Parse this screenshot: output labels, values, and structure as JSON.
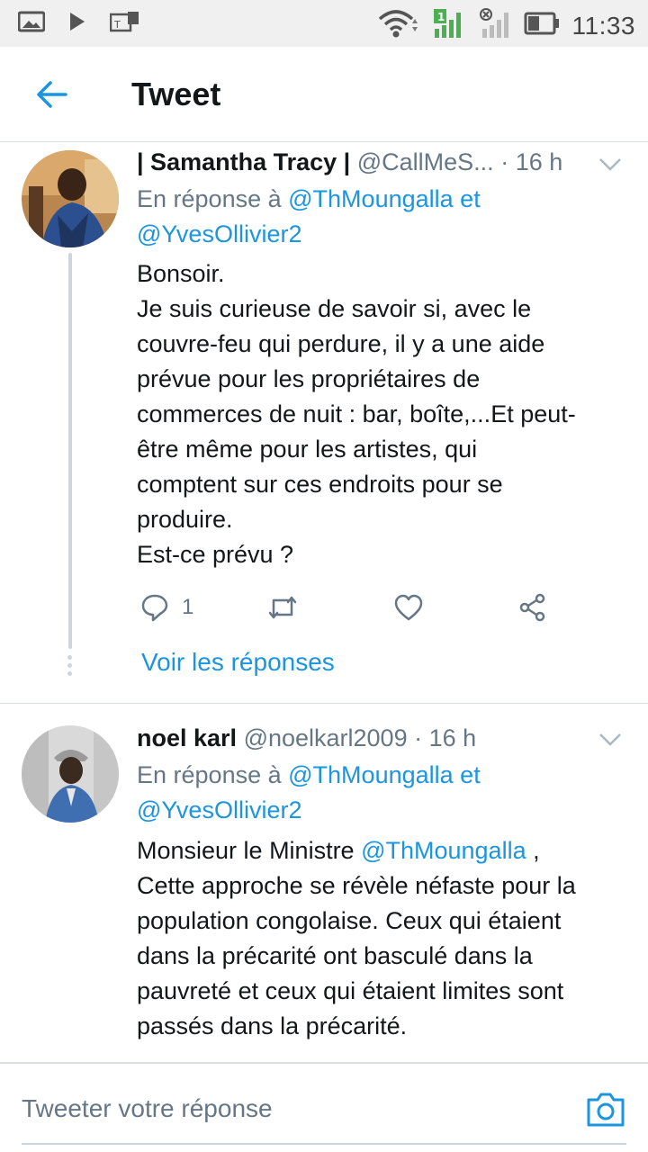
{
  "status_bar": {
    "time": "11:33"
  },
  "app_bar": {
    "title": "Tweet",
    "back_icon": "arrow-left-icon"
  },
  "tweets": [
    {
      "name": "| Samantha Tracy |",
      "handle": "@CallMeS...",
      "time": "· 16 h",
      "reply_prefix": "En réponse à",
      "reply_handle_1": "@ThMoungalla",
      "reply_joiner": "et",
      "reply_handle_2": "@YvesOllivier2",
      "body_lines": [
        "Bonsoir.",
        "Je suis curieuse de savoir si, avec le",
        "couvre-feu qui perdure, il y a une aide",
        "prévue pour les propriétaires de",
        "commerces de nuit : bar, boîte,...Et peut-",
        "être même pour les artistes, qui",
        "comptent sur ces endroits pour se",
        "produire.",
        "Est-ce prévu ?"
      ],
      "reply_count": "1",
      "see_replies": "Voir les réponses"
    },
    {
      "name": "noel karl",
      "handle": "@noelkarl2009",
      "time": "· 16 h",
      "reply_prefix": "En réponse à",
      "reply_handle_1": "@ThMoungalla",
      "reply_joiner": "et",
      "reply_handle_2": "@YvesOllivier2",
      "body_first_prefix": "Monsieur le Ministre ",
      "body_first_mention": "@ThMoungalla",
      "body_first_suffix": " ,",
      "body_lines": [
        "Cette approche se révèle néfaste pour la",
        "population congolaise. Ceux qui étaient",
        "dans la précarité ont basculé dans la",
        "pauvreté et ceux qui étaient limites sont",
        "passés dans la précarité."
      ]
    }
  ],
  "compose": {
    "placeholder": "Tweeter votre réponse",
    "camera_icon": "camera-icon"
  },
  "colors": {
    "accent": "#1b95e0",
    "text": "#14171a",
    "secondary": "#657786",
    "divider": "#d8dde2"
  }
}
